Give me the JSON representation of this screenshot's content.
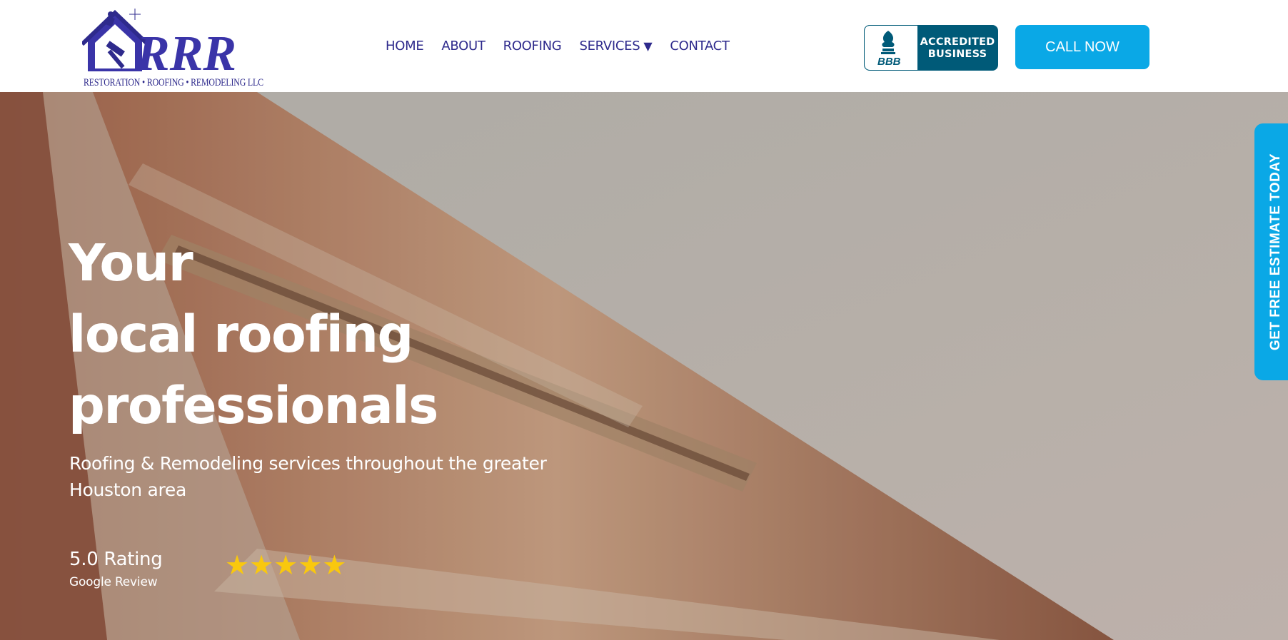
{
  "header": {
    "logo": {
      "letters": "RRR",
      "tagline": "RESTORATION • ROOFING • REMODELING  LLC"
    },
    "nav": [
      {
        "label": "HOME"
      },
      {
        "label": "ABOUT"
      },
      {
        "label": "ROOFING"
      },
      {
        "label": "SERVICES",
        "has_dropdown": true,
        "icon": "caret-down-icon"
      },
      {
        "label": "CONTACT"
      }
    ],
    "bbb_badge": {
      "label": "BBB",
      "line1": "ACCREDITED",
      "line2": "BUSINESS"
    },
    "call_button": "CALL NOW"
  },
  "hero": {
    "title_lines": [
      "Your",
      "local roofing",
      "professionals"
    ],
    "subtitle_line1": "Roofing & Remodeling services throughout the greater",
    "subtitle_line2": "Houston area",
    "rating_value": "5.0 Rating",
    "rating_source": "Google Review",
    "stars": 5,
    "star_glyph": "★"
  },
  "side_tab": "GET FREE ESTIMATE TODAY",
  "colors": {
    "brand_navy": "#2e2a8c",
    "accent_blue": "#0aa8e6",
    "bbb_teal": "#005a78",
    "star_gold": "#f9c80e"
  }
}
